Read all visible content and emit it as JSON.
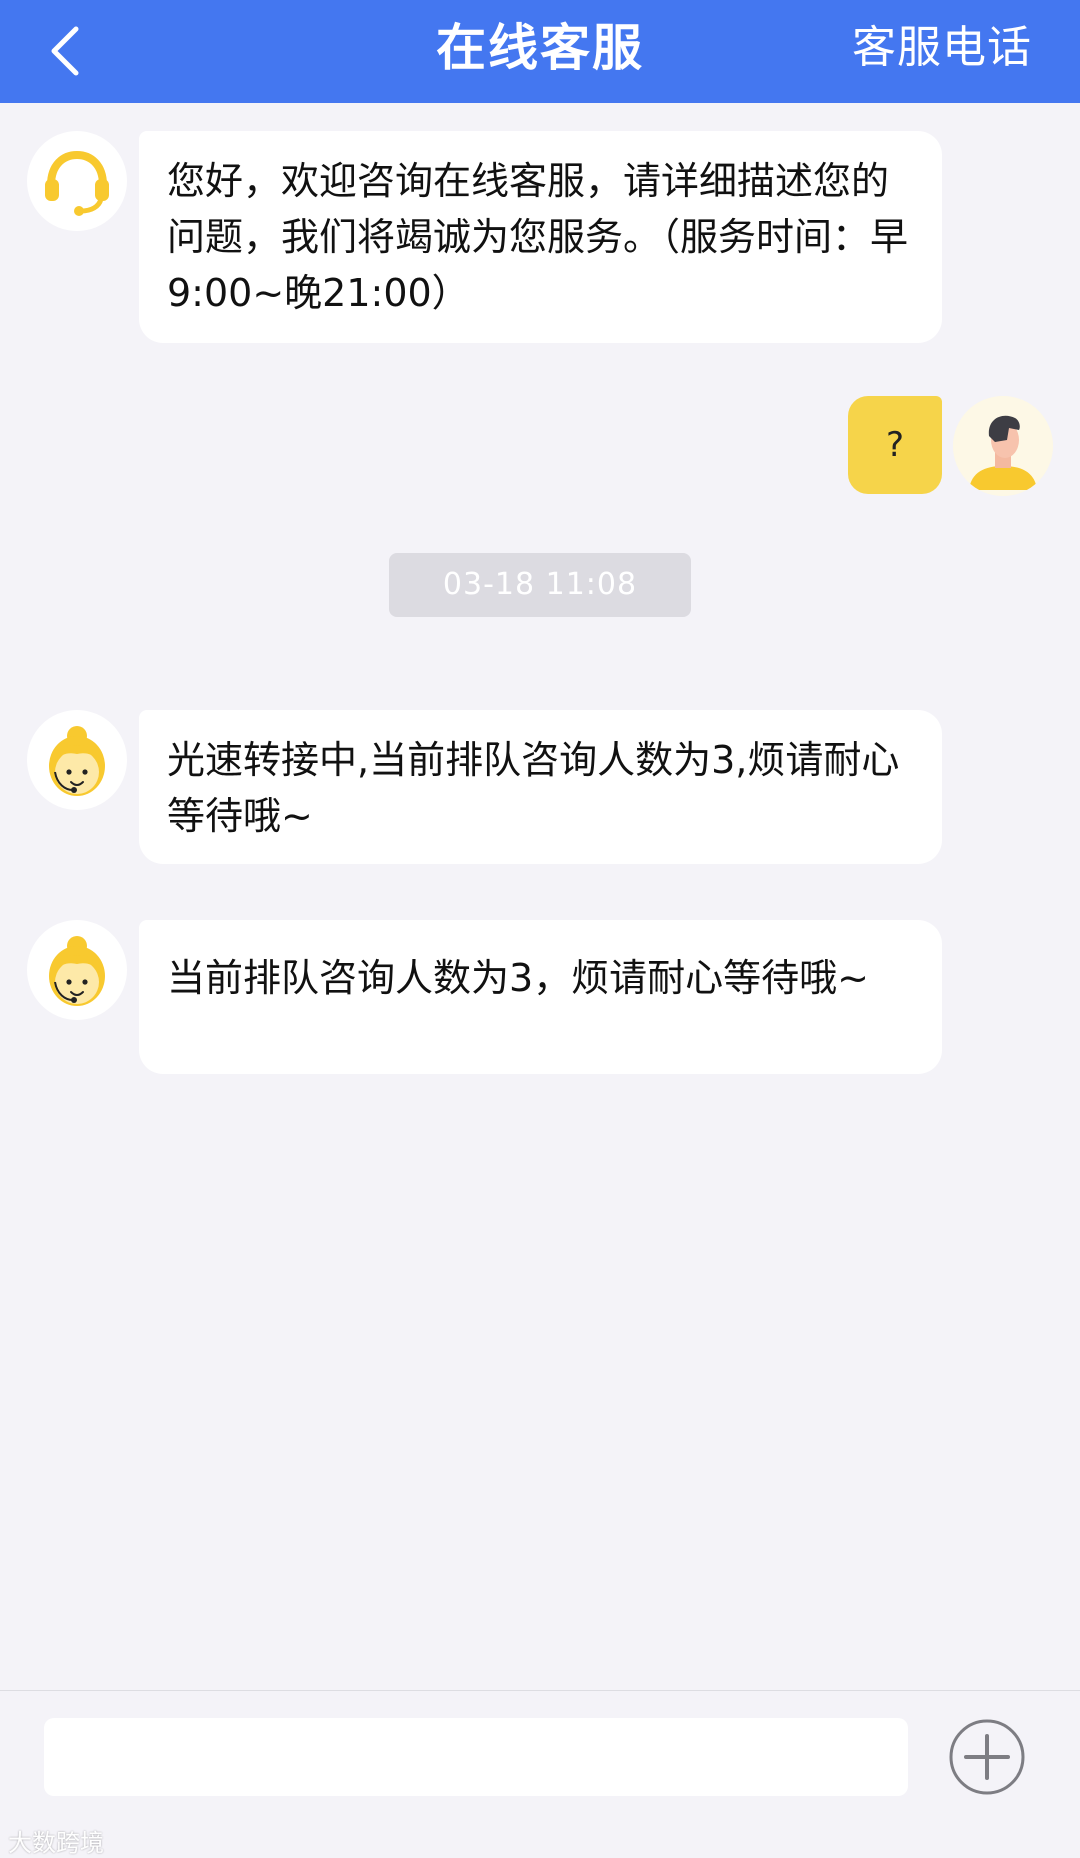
{
  "header": {
    "title": "在线客服",
    "hotline_label": "客服电话",
    "back_icon": "chevron-left-icon",
    "background": "#4477f0"
  },
  "messages": [
    {
      "from": "agent",
      "avatar_icon": "headset-icon",
      "text": "您好，欢迎咨询在线客服，请详细描述您的问题，我们将竭诚为您服务。（服务时间：早9:00~晚21:00）"
    },
    {
      "from": "user",
      "avatar_icon": "user-avatar-icon",
      "text": "?"
    },
    {
      "type": "timestamp",
      "text": "03-18 11:08"
    },
    {
      "from": "agent",
      "avatar_icon": "agent-avatar-icon",
      "text": "光速转接中,当前排队咨询人数为3,烦请耐心等待哦~"
    },
    {
      "from": "agent",
      "avatar_icon": "agent-avatar-icon",
      "text": "当前排队咨询人数为3，烦请耐心等待哦~"
    }
  ],
  "composer": {
    "input_value": "",
    "plus_icon": "plus-circle-icon"
  },
  "watermark": "大数跨境",
  "colors": {
    "accent": "#4477f0",
    "user_bubble": "#f6d44a",
    "avatar_yellow": "#f8c92f",
    "background": "#f4f3f8"
  }
}
